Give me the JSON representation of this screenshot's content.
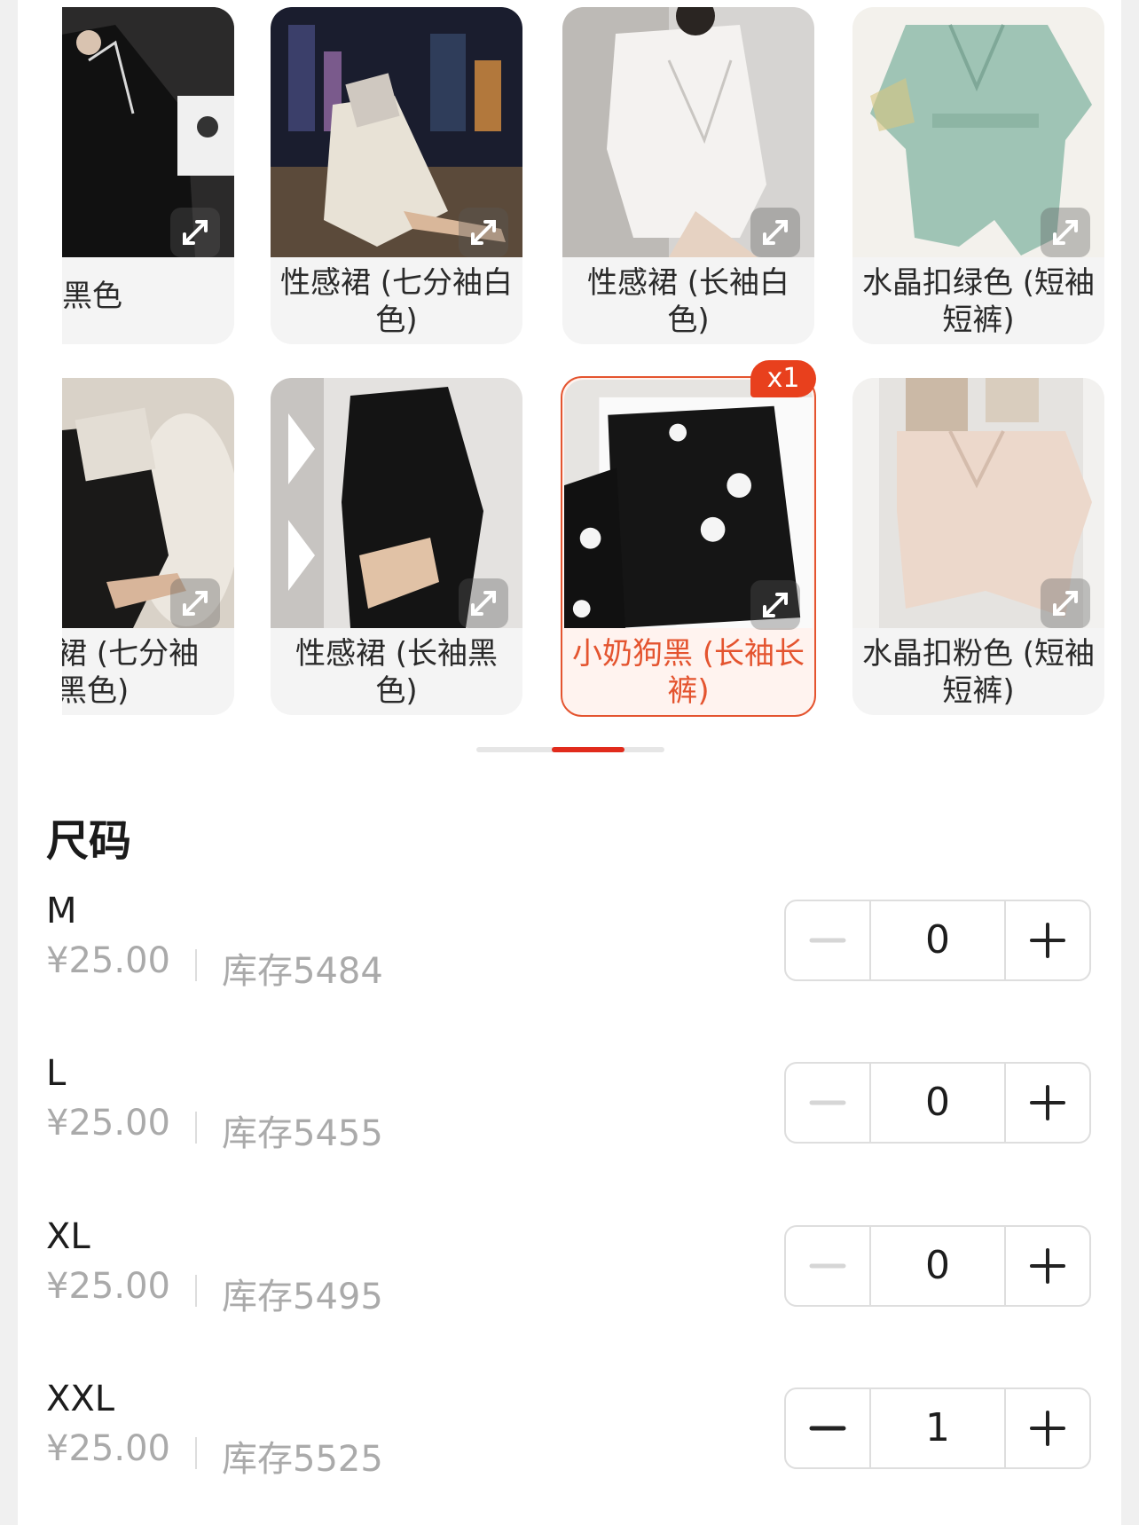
{
  "variants": [
    {
      "label": "艺字母黑色",
      "selected": false,
      "count": null
    },
    {
      "label": "性感裙 (七分袖白色)",
      "selected": false,
      "count": null
    },
    {
      "label": "性感裙 (长袖白色)",
      "selected": false,
      "count": null
    },
    {
      "label": "水晶扣绿色 (短袖短裤)",
      "selected": false,
      "count": null
    },
    {
      "label": "裙 (七分袖黑色)",
      "selected": false,
      "count": null
    },
    {
      "label": "性感裙 (长袖黑色)",
      "selected": false,
      "count": null
    },
    {
      "label": "小奶狗黑 (长袖长裤)",
      "selected": true,
      "count": "x1"
    },
    {
      "label": "水晶扣粉色 (短袖短裤)",
      "selected": false,
      "count": null
    }
  ],
  "size_section": {
    "title": "尺码",
    "sizes": [
      {
        "name": "M",
        "price": "¥25.00",
        "stock": "库存5484",
        "qty": "0"
      },
      {
        "name": "L",
        "price": "¥25.00",
        "stock": "库存5455",
        "qty": "0"
      },
      {
        "name": "XL",
        "price": "¥25.00",
        "stock": "库存5495",
        "qty": "0"
      },
      {
        "name": "XXL",
        "price": "¥25.00",
        "stock": "库存5525",
        "qty": "1"
      }
    ]
  },
  "colors": {
    "accent": "#e4542f",
    "badge": "#e8401d",
    "indicator": "#e12b1c"
  }
}
